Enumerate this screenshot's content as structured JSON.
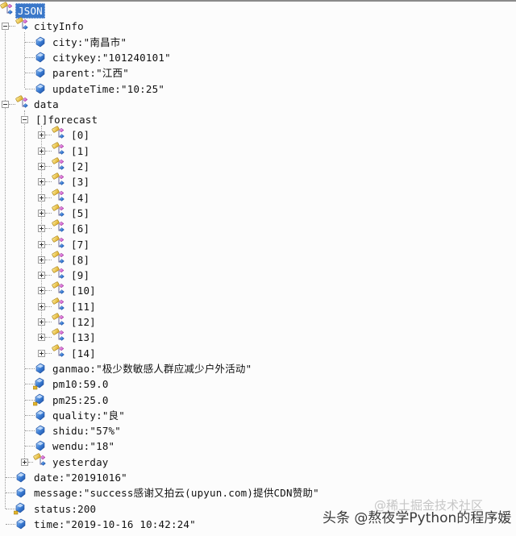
{
  "tree": {
    "root": {
      "label": "JSON",
      "selected": true
    },
    "cityInfo": {
      "key": "cityInfo",
      "expanded": true,
      "fields": [
        {
          "key": "city",
          "sep": " : ",
          "value": "\"南昌市\""
        },
        {
          "key": "citykey",
          "sep": " : ",
          "value": "\"101240101\""
        },
        {
          "key": "parent",
          "sep": " : ",
          "value": "\"江西\""
        },
        {
          "key": "updateTime",
          "sep": " : ",
          "value": "\"10:25\""
        }
      ]
    },
    "data": {
      "key": "data",
      "expanded": true,
      "forecast": {
        "prefix": "[]",
        "key": "forecast",
        "expanded": true,
        "items": [
          "[0]",
          "[1]",
          "[2]",
          "[3]",
          "[4]",
          "[5]",
          "[6]",
          "[7]",
          "[8]",
          "[9]",
          "[10]",
          "[11]",
          "[12]",
          "[13]",
          "[14]"
        ]
      },
      "fields": [
        {
          "key": "ganmao",
          "sep": " : ",
          "value": "\"极少数敏感人群应减少户外活动\"",
          "type": "string"
        },
        {
          "key": "pm10",
          "sep": " : ",
          "value": "59.0",
          "type": "number"
        },
        {
          "key": "pm25",
          "sep": " : ",
          "value": "25.0",
          "type": "number"
        },
        {
          "key": "quality",
          "sep": " : ",
          "value": "\"良\"",
          "type": "string"
        },
        {
          "key": "shidu",
          "sep": " : ",
          "value": "\"57%\"",
          "type": "string"
        },
        {
          "key": "wendu",
          "sep": " : ",
          "value": "\"18\"",
          "type": "string"
        }
      ],
      "yesterday": {
        "key": "yesterday",
        "expanded": false
      }
    },
    "top_fields": [
      {
        "key": "date",
        "sep": " : ",
        "value": "\"20191016\"",
        "type": "string"
      },
      {
        "key": "message",
        "sep": " : ",
        "value": "\"success感谢又拍云(upyun.com)提供CDN赞助\"",
        "type": "string"
      },
      {
        "key": "status",
        "sep": " : ",
        "value": "200",
        "type": "number"
      },
      {
        "key": "time",
        "sep": " : ",
        "value": "\"2019-10-16 10:42:24\"",
        "type": "string"
      }
    ]
  },
  "watermark": {
    "text": "头条 @熬夜学Python的程序媛",
    "faint_text": "@稀土掘金技术社区"
  },
  "colors": {
    "selection": "#3b78c9",
    "border": "#8a8a8a"
  }
}
